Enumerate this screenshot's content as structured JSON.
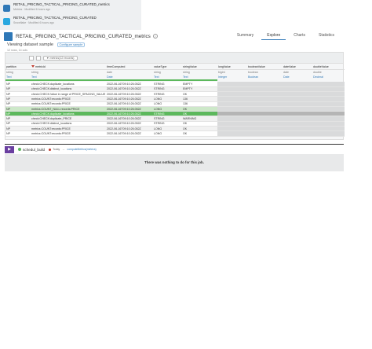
{
  "file_list": [
    {
      "title": "RETAIL_PRICING_TACTICAL_PRICING_CURATED_metrics",
      "subtitle": "Metrics · Modified 6 hours ago",
      "icon_color": "#2f78b7"
    },
    {
      "title": "RETAIL_PRICING_TACTICAL_PRICING_CURATED",
      "subtitle": "Snowflake · Modified 6 hours ago",
      "icon_color": "#29a8e0"
    }
  ],
  "header": {
    "title": "RETAIL_PRICING_TACTICAL_PRICING_CURATED_metrics",
    "tabs": [
      "Summary",
      "Explore",
      "Charts",
      "Statistics"
    ],
    "active_tab": "Explore"
  },
  "viewing": {
    "label": "Viewing dataset sample",
    "badge": "Configure sample",
    "info": "12 rows, 14 cols"
  },
  "toolbar": {
    "filter_label": "▼ metrics(12 records)"
  },
  "table": {
    "columns": [
      "partition",
      "metricId",
      "timeComputed",
      "valueType",
      "stringValue",
      "longValue",
      "booleanValue",
      "dateValue",
      "doubleValue"
    ],
    "types": [
      "string",
      "string",
      "date",
      "string",
      "string",
      "bigint",
      "boolean",
      "date",
      "double"
    ],
    "meanings": [
      "Text",
      "Text",
      "Date",
      "Text",
      "Text",
      "Integer",
      "Boolean",
      "Date",
      "Decimal"
    ],
    "rows": [
      [
        "NP",
        "check:CHECK:duplicate_locations",
        "2022-06-16T09:10:26.052Z",
        "STRING",
        "EMPTY",
        "",
        "",
        "",
        ""
      ],
      [
        "NP",
        "check:CHECK:distinct_locations",
        "2022-06-16T09:10:26.052Z",
        "STRING",
        "EMPTY",
        "",
        "",
        "",
        ""
      ],
      [
        "NP",
        "check:CHECK:Value in range of PRICE_SPACING_VALUE",
        "2022-06-16T09:10:26.052Z",
        "STRING",
        "OK",
        "",
        "",
        "",
        ""
      ],
      [
        "NP",
        "metrics:COUNT:records:PRICE",
        "2022-06-16T09:10:26.052Z",
        "LONG",
        "136",
        "",
        "",
        "",
        ""
      ],
      [
        "NP",
        "metrics:COUNT:records:PRICE",
        "2022-06-16T09:10:26.052Z",
        "LONG",
        "136",
        "",
        "",
        "",
        ""
      ],
      [
        "NP",
        "metrics:COUNT_NULL:records:PRICE",
        "2022-06-16T09:10:26.052Z",
        "LONG",
        "OK",
        "",
        "",
        "",
        ""
      ],
      [
        "NP",
        "check:CHECK:duplicate_locations",
        "2022-06-16T09:10:26.052Z",
        "STRING",
        "OK",
        "",
        "",
        "",
        ""
      ],
      [
        "NP",
        "check:CHECK:duplicate_PRICE",
        "2022-06-16T09:10:26.052Z",
        "STRING",
        "WARNING",
        "",
        "",
        "",
        ""
      ],
      [
        "NP",
        "check:CHECK:distinct_locations",
        "2022-06-16T09:10:26.052Z",
        "STRING",
        "OK",
        "",
        "",
        "",
        ""
      ],
      [
        "NP",
        "metrics:COUNT:records:PRICE",
        "2022-06-16T09:10:26.052Z",
        "LONG",
        "OK",
        "",
        "",
        "",
        ""
      ],
      [
        "NP",
        "metrics:COUNT:records:PRICE",
        "2022-06-16T09:10:26.052Z",
        "LONG",
        "OK",
        "",
        "",
        "",
        ""
      ]
    ],
    "highlight_row": 5,
    "selected_row": 6
  },
  "job": {
    "name": "schedul_build",
    "meta": "Today",
    "meta_link": "computeMetrics(metrics)",
    "message": "There was nothing to do for this job."
  }
}
